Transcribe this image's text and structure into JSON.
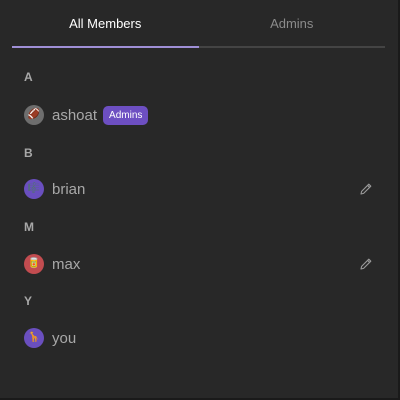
{
  "tabs": [
    {
      "label": "All Members",
      "active": true
    },
    {
      "label": "Admins",
      "active": false
    }
  ],
  "sections": [
    {
      "letter": "A",
      "members": [
        {
          "name": "ashoat",
          "avatar_emoji": "🏈",
          "avatar_color": "#6e6e6e",
          "badge": "Admins",
          "editable": false
        }
      ]
    },
    {
      "letter": "B",
      "members": [
        {
          "name": "brian",
          "avatar_emoji": "🎼",
          "avatar_color": "#6a4fbf",
          "badge": "",
          "editable": true
        }
      ]
    },
    {
      "letter": "M",
      "members": [
        {
          "name": "max",
          "avatar_emoji": "🥫",
          "avatar_color": "#c24c50",
          "badge": "",
          "editable": true
        }
      ]
    },
    {
      "letter": "Y",
      "members": [
        {
          "name": "you",
          "avatar_emoji": "🦒",
          "avatar_color": "#6a4fbf",
          "badge": "",
          "editable": false
        }
      ]
    }
  ],
  "colors": {
    "background": "#282828",
    "accent": "#6d4fc2",
    "active_tab_underline": "#9f8fd6"
  },
  "icons": {
    "edit": "pencil-icon"
  }
}
